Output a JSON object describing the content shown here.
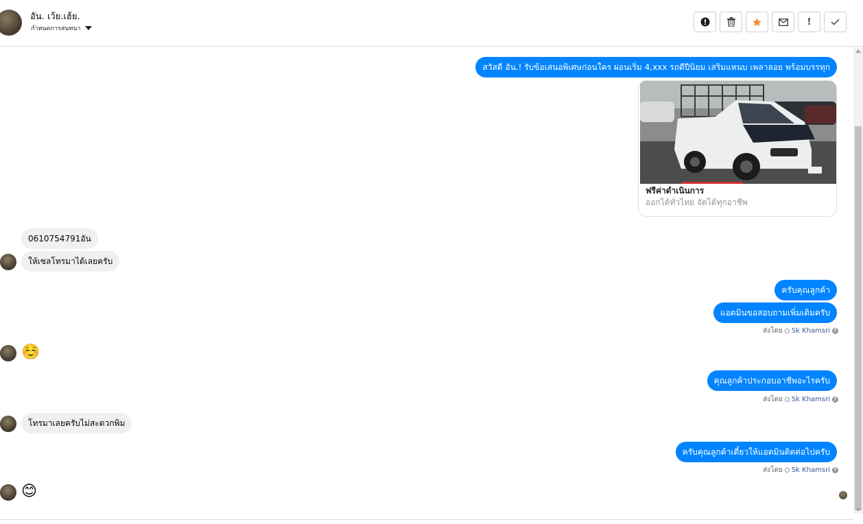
{
  "header": {
    "name": "อัน. เว้ย.เฮ้ย.",
    "subtitle": "กำหนดการสนทนา"
  },
  "toolbar": {
    "buttons": [
      {
        "icon": "alert-circle-icon"
      },
      {
        "icon": "trash-icon"
      },
      {
        "icon": "star-icon",
        "color": "#f68c28"
      },
      {
        "icon": "envelope-icon"
      },
      {
        "icon": "exclamation-icon",
        "glyph": "!"
      },
      {
        "icon": "check-icon"
      }
    ]
  },
  "messages": {
    "m1": "สวัสดี อัน.! รับข้อเสนอพิเศษก่อนใคร ผ่อนเริ่ม 4,xxx รถดีปีนิยม เสริมแหนบ เพลาลอย พร้อมบรรทุก",
    "card": {
      "title": "ฟรีค่าดำเนินการ",
      "description": "ออกได้ทั่วไทย จัดได้ทุกอาชีพ"
    },
    "m2": "0610754791อัน",
    "m3": "ให้เซลโทรมาได้เลยครับ",
    "m4": "ครับคุณลูกค้า",
    "m5": "แอดมินขอสอบถามเพิ่มเติมครับ",
    "emoji1": "☺️",
    "m6": "คุณลูกค้าประกอบอาชีพอะไรครับ",
    "m7": "โทรมาเลยครับไม่สะดวกพิม",
    "m8": "ครับคุณลูกค้าเดี๋ยวให้แอดมินติดต่อไปครับ",
    "emoji2": "😊"
  },
  "sent_by": {
    "label": "ส่งโดย",
    "agent": "Sk Khamsri",
    "help": "?"
  },
  "colors": {
    "outgoing": "#0084ff",
    "incoming": "#f1f0f0",
    "star": "#f68c28"
  }
}
